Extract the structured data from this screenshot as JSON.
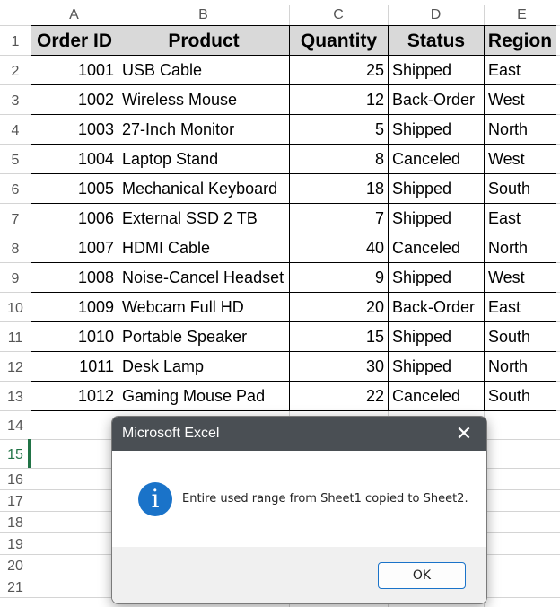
{
  "columns": [
    "A",
    "B",
    "C",
    "D",
    "E"
  ],
  "rows": [
    "1",
    "2",
    "3",
    "4",
    "5",
    "6",
    "7",
    "8",
    "9",
    "10",
    "11",
    "12",
    "13",
    "14",
    "15",
    "16",
    "17",
    "18",
    "19",
    "20",
    "21"
  ],
  "table": {
    "headers": [
      "Order ID",
      "Product",
      "Quantity",
      "Status",
      "Region"
    ],
    "data": [
      [
        "1001",
        "USB Cable",
        "25",
        "Shipped",
        "East"
      ],
      [
        "1002",
        "Wireless Mouse",
        "12",
        "Back-Order",
        "West"
      ],
      [
        "1003",
        "27-Inch Monitor",
        "5",
        "Shipped",
        "North"
      ],
      [
        "1004",
        "Laptop Stand",
        "8",
        "Canceled",
        "West"
      ],
      [
        "1005",
        "Mechanical Keyboard",
        "18",
        "Shipped",
        "South"
      ],
      [
        "1006",
        "External SSD 2 TB",
        "7",
        "Shipped",
        "East"
      ],
      [
        "1007",
        "HDMI Cable",
        "40",
        "Canceled",
        "North"
      ],
      [
        "1008",
        "Noise-Cancel Headset",
        "9",
        "Shipped",
        "West"
      ],
      [
        "1009",
        "Webcam Full HD",
        "20",
        "Back-Order",
        "East"
      ],
      [
        "1010",
        "Portable Speaker",
        "15",
        "Shipped",
        "South"
      ],
      [
        "1011",
        "Desk Lamp",
        "30",
        "Shipped",
        "North"
      ],
      [
        "1012",
        "Gaming Mouse Pad",
        "22",
        "Canceled",
        "South"
      ]
    ]
  },
  "dialog": {
    "title": "Microsoft Excel",
    "message": "Entire used range from Sheet1 copied to Sheet2.",
    "ok_label": "OK",
    "close_glyph": "✕",
    "icon": "info-icon",
    "icon_glyph": "i"
  },
  "active_row": "15",
  "colors": {
    "accent": "#217346",
    "dialog_title_bg": "#4a4f54",
    "header_fill": "#d9d9d9",
    "info_blue": "#1a73c9"
  }
}
